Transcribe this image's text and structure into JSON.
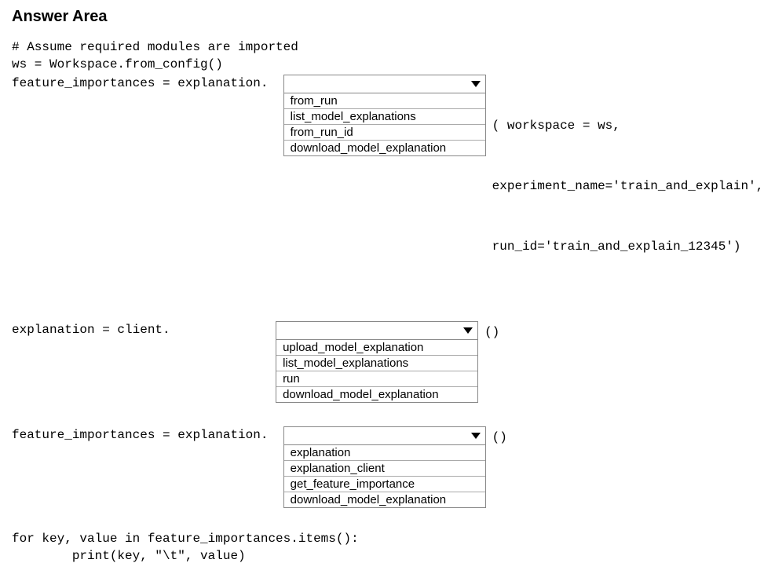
{
  "title": "Answer Area",
  "comment": "# Assume required modules are imported",
  "line_ws": "ws = Workspace.from_config()",
  "row1": {
    "label": "feature_importances = explanation.  ",
    "options": [
      "from_run",
      "list_model_explanations",
      "from_run_id",
      "download_model_explanation"
    ],
    "after_line1": "( workspace = ws,",
    "after_line2": "experiment_name='train_and_explain',",
    "after_line3": "run_id='train_and_explain_12345')"
  },
  "row2": {
    "label": "explanation = client.              ",
    "options": [
      "upload_model_explanation",
      "list_model_explanations",
      "run",
      "download_model_explanation"
    ],
    "after": "()"
  },
  "row3": {
    "label": "feature_importances = explanation.  ",
    "options": [
      "explanation",
      "explanation_client",
      "get_feature_importance",
      "download_model_explanation"
    ],
    "after": "()"
  },
  "loop_line1": "for key, value in feature_importances.items():",
  "loop_line2": "        print(key, \"\\t\", value)"
}
